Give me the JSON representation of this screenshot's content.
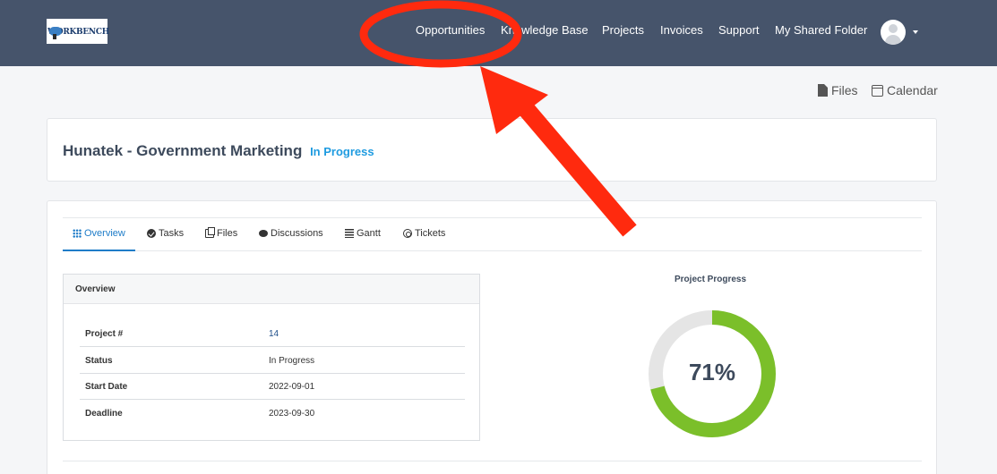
{
  "brand": {
    "logo_text": "WORKBENCH"
  },
  "nav": {
    "items": [
      {
        "label": "Opportunities"
      },
      {
        "label": "Knowledge Base"
      },
      {
        "label": "Projects"
      },
      {
        "label": "Invoices"
      },
      {
        "label": "Support"
      },
      {
        "label": "My Shared Folder"
      }
    ]
  },
  "toolbar": {
    "files_label": "Files",
    "calendar_label": "Calendar"
  },
  "project": {
    "title": "Hunatek - Government Marketing",
    "status": "In Progress"
  },
  "tabs": [
    {
      "label": "Overview",
      "icon": "grid-icon",
      "active": true
    },
    {
      "label": "Tasks",
      "icon": "check-circle-icon"
    },
    {
      "label": "Files",
      "icon": "files-icon"
    },
    {
      "label": "Discussions",
      "icon": "chat-icon"
    },
    {
      "label": "Gantt",
      "icon": "gantt-icon"
    },
    {
      "label": "Tickets",
      "icon": "lifebuoy-icon"
    }
  ],
  "overview": {
    "heading": "Overview",
    "rows": [
      {
        "label": "Project #",
        "value": "14"
      },
      {
        "label": "Status",
        "value": "In Progress"
      },
      {
        "label": "Start Date",
        "value": "2022-09-01"
      },
      {
        "label": "Deadline",
        "value": "2023-09-30"
      }
    ]
  },
  "progress": {
    "title": "Project Progress",
    "percent": 71,
    "label": "71%"
  },
  "colors": {
    "header_bg": "#46546b",
    "accent_blue": "#1e9be0",
    "progress_green": "#7bbf2a",
    "progress_track": "#e5e5e5",
    "annotation_red": "#ff2a0e"
  }
}
